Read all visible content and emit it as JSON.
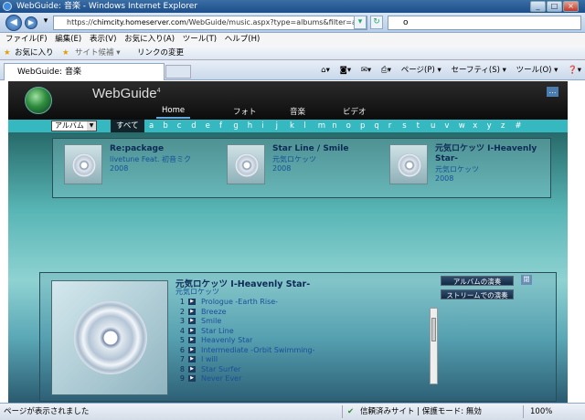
{
  "window": {
    "title": "WebGuide: 音楽 - Windows Internet Explorer",
    "controls": [
      "_",
      "□",
      "×"
    ]
  },
  "address": {
    "scheme": "https://",
    "host": "chimcity.homeserver.com",
    "path": "/WebGuide/music.aspx?type=albums&filter=a",
    "search_value": "o"
  },
  "menu": [
    "ファイル(F)",
    "編集(E)",
    "表示(V)",
    "お気に入り(A)",
    "ツール(T)",
    "ヘルプ(H)"
  ],
  "favorites": {
    "label": "お気に入り",
    "site": "サイト候補 ▾",
    "link": "リンクの変更"
  },
  "tab": {
    "label": "WebGuide: 音楽"
  },
  "commands": [
    "ページ(P) ▾",
    "セーフティ(S) ▾",
    "ツール(O) ▾"
  ],
  "site": {
    "logo": "WebGuide",
    "logo_sup": "4",
    "nav": [
      "Home",
      "フォト",
      "音楽",
      "ビデオ"
    ],
    "more": "…",
    "alpha_select": "アルバム",
    "alpha_all": "すべて",
    "letters": [
      "a",
      "b",
      "c",
      "d",
      "e",
      "f",
      "g",
      "h",
      "i",
      "j",
      "k",
      "l",
      "m",
      "n",
      "o",
      "p",
      "q",
      "r",
      "s",
      "t",
      "u",
      "v",
      "w",
      "x",
      "y",
      "z",
      "#"
    ]
  },
  "albums": [
    {
      "title": "Re:package",
      "artist": "livetune Feat. 初音ミク",
      "year": "2008"
    },
    {
      "title": "Star Line / Smile",
      "artist": "元気ロケッツ",
      "year": "2008"
    },
    {
      "title": "元気ロケッツ Ⅰ-Heavenly Star-",
      "artist": "元気ロケッツ",
      "year": "2008"
    }
  ],
  "detail": {
    "title": "元気ロケッツ Ⅰ-Heavenly Star-",
    "artist": "元気ロケッツ",
    "buttons": [
      "アルバムの演奏",
      "ストリームでの演奏"
    ],
    "close": "閉",
    "tracks": [
      {
        "n": "1",
        "title": "Prologue -Earth Rise-"
      },
      {
        "n": "2",
        "title": "Breeze"
      },
      {
        "n": "3",
        "title": "Smile"
      },
      {
        "n": "4",
        "title": "Star Line"
      },
      {
        "n": "5",
        "title": "Heavenly Star"
      },
      {
        "n": "6",
        "title": "Intermediate -Orbit Swimming-"
      },
      {
        "n": "7",
        "title": "I will"
      },
      {
        "n": "8",
        "title": "Star Surfer"
      },
      {
        "n": "9",
        "title": "Never Ever"
      }
    ]
  },
  "status": {
    "left": "ページが表示されました",
    "zone": "信頼済みサイト | 保護モード: 無効",
    "zoom": "100%"
  }
}
